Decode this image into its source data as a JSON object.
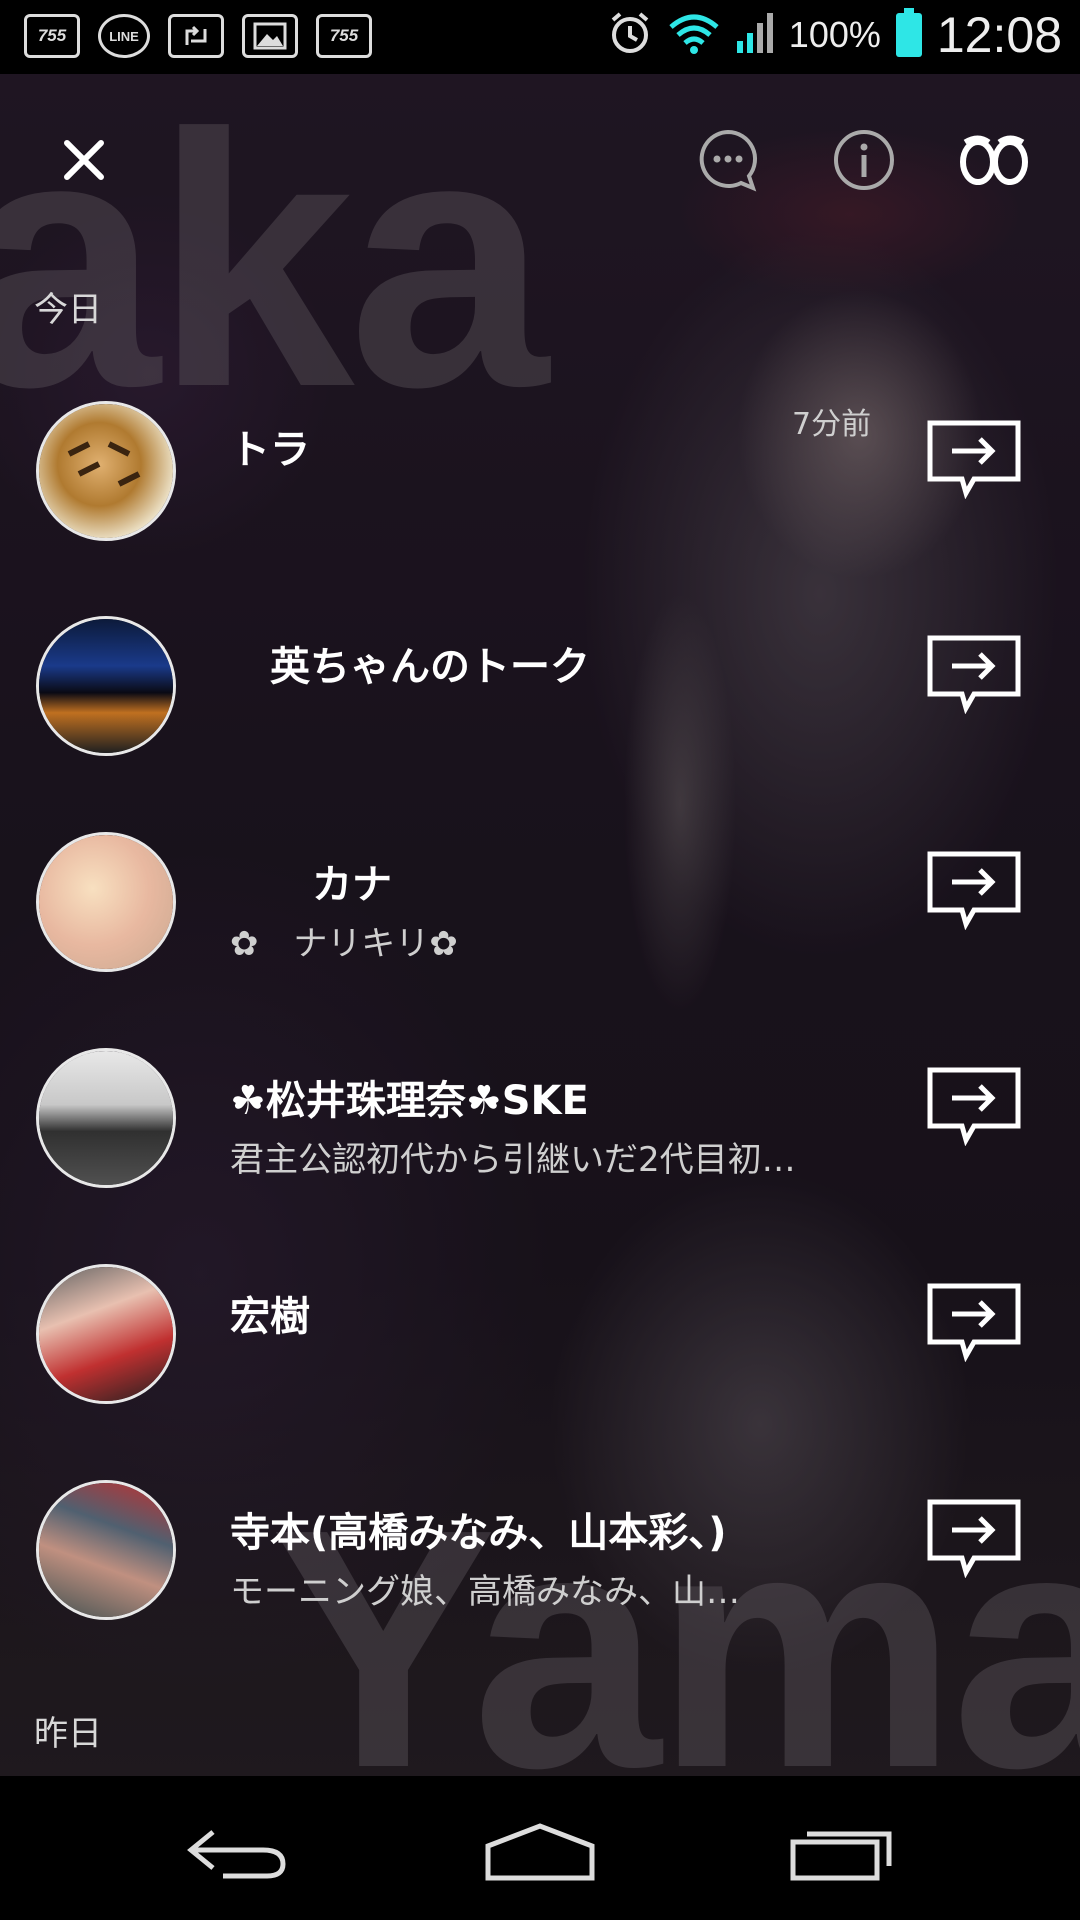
{
  "status_bar": {
    "notifications": [
      "755",
      "LINE",
      "755"
    ],
    "battery": "100%",
    "time": "12:08"
  },
  "header": {
    "icons": [
      "close-icon",
      "chat-bubble-icon",
      "info-icon",
      "eyes-icon"
    ]
  },
  "background_text": {
    "top": "aka",
    "bottom": "Yamar"
  },
  "sections": {
    "today": "今日",
    "yesterday": "昨日"
  },
  "chats": [
    {
      "name": "トラ",
      "preview": "",
      "time": "7分前",
      "avatar_colors": [
        "#c8a070",
        "#7a5a30"
      ]
    },
    {
      "name": "英ちゃんのトーク",
      "preview": "",
      "time": "",
      "avatar_colors": [
        "#1a3a8a",
        "#d07020"
      ]
    },
    {
      "name": "カナ",
      "preview": "ナリキリ",
      "time": "",
      "avatar_colors": [
        "#f0c8a0",
        "#d8a8a0"
      ]
    },
    {
      "name": "松井珠理奈",
      "name_suffix": "SKE",
      "preview": "君主公認初代から引継いだ2代目初…",
      "time": "",
      "avatar_colors": [
        "#d8d8d8",
        "#404040"
      ]
    },
    {
      "name": "宏樹",
      "preview": "",
      "time": "",
      "avatar_colors": [
        "#c04040",
        "#e8c0b0"
      ]
    },
    {
      "name": "寺本(高橋みなみ、山本彩、)",
      "preview": "モーニング娘、高橋みなみ、山…",
      "time": "",
      "avatar_colors": [
        "#506070",
        "#c09080"
      ]
    }
  ],
  "colors": {
    "text": "#ffffff",
    "subtext": "#cfcfcf",
    "battery": "#2ee6e6",
    "wifi": "#2ee6e6"
  }
}
